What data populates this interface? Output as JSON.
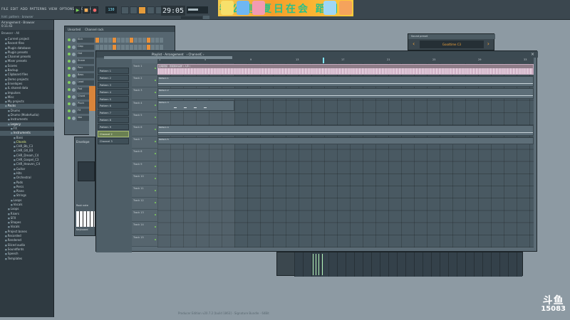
{
  "toolbar": {
    "menus": [
      "FILE",
      "EDIT",
      "ADD",
      "PATTERNS",
      "VIEW",
      "OPTIONS",
      "TOOLS",
      "HELP"
    ],
    "hint_text": "hint: pattern · browser",
    "transport": {
      "play": "▶",
      "stop": "■",
      "record": "●"
    },
    "tempo": "130",
    "clock": "29:05"
  },
  "banner": {
    "text": "都公测 夏日在会 蹈园笑"
  },
  "browser": {
    "header_lines": [
      "Arrangement - Browser",
      "0:11:43"
    ],
    "title": "Browser - All",
    "items": [
      {
        "label": "Current project",
        "level": 0
      },
      {
        "label": "Recent files",
        "level": 0
      },
      {
        "label": "Plugin database",
        "level": 0
      },
      {
        "label": "Plugin presets",
        "level": 0
      },
      {
        "label": "Channel presets",
        "level": 0
      },
      {
        "label": "Mixer presets",
        "level": 0
      },
      {
        "label": "Scores",
        "level": 0
      },
      {
        "label": "Backup",
        "level": 0
      },
      {
        "label": "Clipboard files",
        "level": 0
      },
      {
        "label": "Demo projects",
        "level": 0
      },
      {
        "label": "Envelopes",
        "level": 0
      },
      {
        "label": "IL shared data",
        "level": 0
      },
      {
        "label": "Impulses",
        "level": 0
      },
      {
        "label": "Misc",
        "level": 0
      },
      {
        "label": "My projects",
        "level": 0
      },
      {
        "label": "Packs",
        "level": 0
      },
      {
        "label": "Drums",
        "level": 1
      },
      {
        "label": "Drums (ModeAudio)",
        "level": 1
      },
      {
        "label": "Instruments",
        "level": 1
      },
      {
        "label": "Legacy",
        "level": 1
      },
      {
        "label": "FX",
        "level": 2
      },
      {
        "label": "Instruments",
        "level": 2
      },
      {
        "label": "Bass",
        "level": 3
      },
      {
        "label": "Chords",
        "level": 3
      },
      {
        "label": "CHR_Bb_C3",
        "level": 3
      },
      {
        "label": "CHR_Gtl_B3",
        "level": 3
      },
      {
        "label": "CHR_Dream_C4",
        "level": 3
      },
      {
        "label": "CHR_Gospel_C3",
        "level": 3
      },
      {
        "label": "CHR_Heaven_C4",
        "level": 3
      },
      {
        "label": "Guitar",
        "level": 3
      },
      {
        "label": "Hits",
        "level": 3
      },
      {
        "label": "Orchestral",
        "level": 3
      },
      {
        "label": "Pads",
        "level": 3
      },
      {
        "label": "Percs",
        "level": 3
      },
      {
        "label": "Piano",
        "level": 3
      },
      {
        "label": "Strings",
        "level": 3
      },
      {
        "label": "Loops",
        "level": 2
      },
      {
        "label": "Vocals",
        "level": 2
      },
      {
        "label": "Loops",
        "level": 1
      },
      {
        "label": "Risers",
        "level": 1
      },
      {
        "label": "SFX",
        "level": 1
      },
      {
        "label": "Shapes",
        "level": 1
      },
      {
        "label": "Vocals",
        "level": 1
      },
      {
        "label": "Project bones",
        "level": 0
      },
      {
        "label": "Recorded",
        "level": 0
      },
      {
        "label": "Rendered",
        "level": 0
      },
      {
        "label": "Sliced audio",
        "level": 0
      },
      {
        "label": "Soundfonts",
        "level": 0
      },
      {
        "label": "Speech",
        "level": 0
      },
      {
        "label": "Templates",
        "level": 0
      }
    ]
  },
  "channel_rack": {
    "title_a": "Channel rack",
    "title_b": "Unsorted",
    "channels": [
      "Kick",
      "Clap",
      "Hat",
      "Snare",
      "Perc",
      "Bass",
      "Lead",
      "Pad",
      "Chord",
      "Pluck",
      "FX",
      "Vox"
    ]
  },
  "plugin": {
    "tab_a": "Envelope",
    "tab_b": "Root note",
    "tab_c": "Keyboard"
  },
  "playlist": {
    "title": "Playlist - Arrangement",
    "breadcrumb": "› ChannelC ›",
    "ruler": [
      "1",
      "5",
      "9",
      "13",
      "17",
      "21",
      "25",
      "29",
      "33"
    ],
    "clips_list": [
      "Pattern 1",
      "Pattern 2",
      "Pattern 3",
      "Pattern 4",
      "Pattern 5",
      "Pattern 6",
      "Pattern 7",
      "Pattern 8",
      "Pattern 9",
      "Channel 2",
      "Channel 3"
    ],
    "tracks": [
      "Track 1",
      "Track 2",
      "Track 3",
      "Track 4",
      "Track 5",
      "Track 6",
      "Track 7",
      "Track 8",
      "Track 9",
      "Track 10",
      "Track 11",
      "Track 12",
      "Track 13",
      "Track 14",
      "Track 15"
    ],
    "audio_clip_label": "主唱音频 · 音频素材采样 ( 人声 )",
    "pattern_labels": [
      "Pattern 1",
      "Pattern 2",
      "Pattern 3",
      "Pattern 4",
      "Pattern 5"
    ]
  },
  "minisynth": {
    "title": "Sound preset",
    "value": "Goodtime C3"
  },
  "status": {
    "text": "Producer Edition v20.7.2 [build 1863] - Signature Bundle - 64Bit"
  },
  "watermark": {
    "logo": "斗鱼",
    "room": "15083"
  }
}
